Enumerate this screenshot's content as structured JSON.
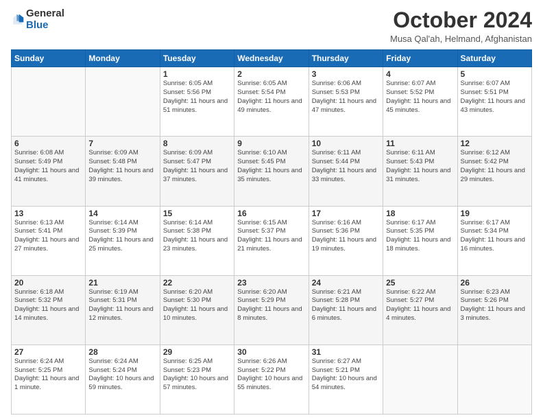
{
  "header": {
    "logo_general": "General",
    "logo_blue": "Blue",
    "month_title": "October 2024",
    "location": "Musa Qal'ah, Helmand, Afghanistan"
  },
  "days_of_week": [
    "Sunday",
    "Monday",
    "Tuesday",
    "Wednesday",
    "Thursday",
    "Friday",
    "Saturday"
  ],
  "weeks": [
    [
      {
        "day": "",
        "info": ""
      },
      {
        "day": "",
        "info": ""
      },
      {
        "day": "1",
        "info": "Sunrise: 6:05 AM\nSunset: 5:56 PM\nDaylight: 11 hours and 51 minutes."
      },
      {
        "day": "2",
        "info": "Sunrise: 6:05 AM\nSunset: 5:54 PM\nDaylight: 11 hours and 49 minutes."
      },
      {
        "day": "3",
        "info": "Sunrise: 6:06 AM\nSunset: 5:53 PM\nDaylight: 11 hours and 47 minutes."
      },
      {
        "day": "4",
        "info": "Sunrise: 6:07 AM\nSunset: 5:52 PM\nDaylight: 11 hours and 45 minutes."
      },
      {
        "day": "5",
        "info": "Sunrise: 6:07 AM\nSunset: 5:51 PM\nDaylight: 11 hours and 43 minutes."
      }
    ],
    [
      {
        "day": "6",
        "info": "Sunrise: 6:08 AM\nSunset: 5:49 PM\nDaylight: 11 hours and 41 minutes."
      },
      {
        "day": "7",
        "info": "Sunrise: 6:09 AM\nSunset: 5:48 PM\nDaylight: 11 hours and 39 minutes."
      },
      {
        "day": "8",
        "info": "Sunrise: 6:09 AM\nSunset: 5:47 PM\nDaylight: 11 hours and 37 minutes."
      },
      {
        "day": "9",
        "info": "Sunrise: 6:10 AM\nSunset: 5:45 PM\nDaylight: 11 hours and 35 minutes."
      },
      {
        "day": "10",
        "info": "Sunrise: 6:11 AM\nSunset: 5:44 PM\nDaylight: 11 hours and 33 minutes."
      },
      {
        "day": "11",
        "info": "Sunrise: 6:11 AM\nSunset: 5:43 PM\nDaylight: 11 hours and 31 minutes."
      },
      {
        "day": "12",
        "info": "Sunrise: 6:12 AM\nSunset: 5:42 PM\nDaylight: 11 hours and 29 minutes."
      }
    ],
    [
      {
        "day": "13",
        "info": "Sunrise: 6:13 AM\nSunset: 5:41 PM\nDaylight: 11 hours and 27 minutes."
      },
      {
        "day": "14",
        "info": "Sunrise: 6:14 AM\nSunset: 5:39 PM\nDaylight: 11 hours and 25 minutes."
      },
      {
        "day": "15",
        "info": "Sunrise: 6:14 AM\nSunset: 5:38 PM\nDaylight: 11 hours and 23 minutes."
      },
      {
        "day": "16",
        "info": "Sunrise: 6:15 AM\nSunset: 5:37 PM\nDaylight: 11 hours and 21 minutes."
      },
      {
        "day": "17",
        "info": "Sunrise: 6:16 AM\nSunset: 5:36 PM\nDaylight: 11 hours and 19 minutes."
      },
      {
        "day": "18",
        "info": "Sunrise: 6:17 AM\nSunset: 5:35 PM\nDaylight: 11 hours and 18 minutes."
      },
      {
        "day": "19",
        "info": "Sunrise: 6:17 AM\nSunset: 5:34 PM\nDaylight: 11 hours and 16 minutes."
      }
    ],
    [
      {
        "day": "20",
        "info": "Sunrise: 6:18 AM\nSunset: 5:32 PM\nDaylight: 11 hours and 14 minutes."
      },
      {
        "day": "21",
        "info": "Sunrise: 6:19 AM\nSunset: 5:31 PM\nDaylight: 11 hours and 12 minutes."
      },
      {
        "day": "22",
        "info": "Sunrise: 6:20 AM\nSunset: 5:30 PM\nDaylight: 11 hours and 10 minutes."
      },
      {
        "day": "23",
        "info": "Sunrise: 6:20 AM\nSunset: 5:29 PM\nDaylight: 11 hours and 8 minutes."
      },
      {
        "day": "24",
        "info": "Sunrise: 6:21 AM\nSunset: 5:28 PM\nDaylight: 11 hours and 6 minutes."
      },
      {
        "day": "25",
        "info": "Sunrise: 6:22 AM\nSunset: 5:27 PM\nDaylight: 11 hours and 4 minutes."
      },
      {
        "day": "26",
        "info": "Sunrise: 6:23 AM\nSunset: 5:26 PM\nDaylight: 11 hours and 3 minutes."
      }
    ],
    [
      {
        "day": "27",
        "info": "Sunrise: 6:24 AM\nSunset: 5:25 PM\nDaylight: 11 hours and 1 minute."
      },
      {
        "day": "28",
        "info": "Sunrise: 6:24 AM\nSunset: 5:24 PM\nDaylight: 10 hours and 59 minutes."
      },
      {
        "day": "29",
        "info": "Sunrise: 6:25 AM\nSunset: 5:23 PM\nDaylight: 10 hours and 57 minutes."
      },
      {
        "day": "30",
        "info": "Sunrise: 6:26 AM\nSunset: 5:22 PM\nDaylight: 10 hours and 55 minutes."
      },
      {
        "day": "31",
        "info": "Sunrise: 6:27 AM\nSunset: 5:21 PM\nDaylight: 10 hours and 54 minutes."
      },
      {
        "day": "",
        "info": ""
      },
      {
        "day": "",
        "info": ""
      }
    ]
  ]
}
